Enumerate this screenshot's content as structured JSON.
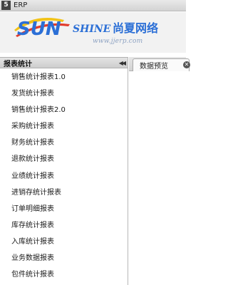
{
  "window": {
    "app_icon": "5",
    "title": "ERP"
  },
  "banner": {
    "logo_letters": "SUN",
    "logo_word": "SHINE",
    "logo_cn": "尚夏网络",
    "logo_url": "www.jjerp.com",
    "colors": {
      "blue": "#2b6fd6",
      "red": "#e23b2b",
      "yellow": "#f2c318"
    }
  },
  "sidebar": {
    "title": "报表统计",
    "collapse_icon": "double-chevron-left-icon",
    "items": [
      {
        "label": "销售统计报表1.0"
      },
      {
        "label": "发货统计报表"
      },
      {
        "label": "销售统计报表2.0"
      },
      {
        "label": "采购统计报表"
      },
      {
        "label": "财务统计报表"
      },
      {
        "label": "退款统计报表"
      },
      {
        "label": "业绩统计报表"
      },
      {
        "label": "进销存统计报表"
      },
      {
        "label": "订单明细报表"
      },
      {
        "label": "库存统计报表"
      },
      {
        "label": "入库统计报表"
      },
      {
        "label": "业务数据报表"
      },
      {
        "label": "包件统计报表"
      }
    ]
  },
  "tabs": [
    {
      "label": "数据预览",
      "close_icon": "close-icon"
    }
  ]
}
